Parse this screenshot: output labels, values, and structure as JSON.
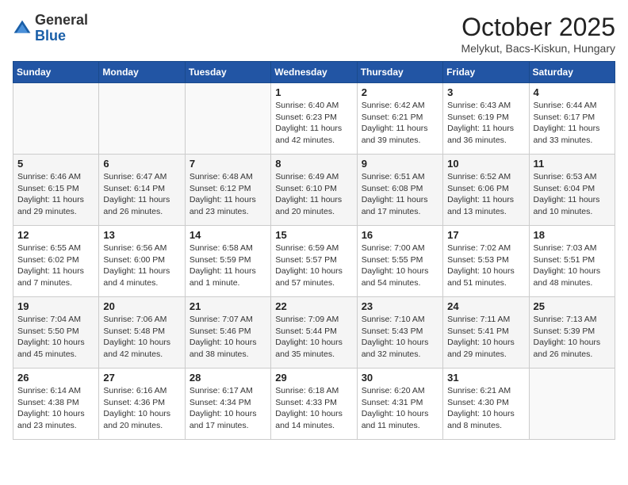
{
  "header": {
    "logo_general": "General",
    "logo_blue": "Blue",
    "month": "October 2025",
    "location": "Melykut, Bacs-Kiskun, Hungary"
  },
  "days_of_week": [
    "Sunday",
    "Monday",
    "Tuesday",
    "Wednesday",
    "Thursday",
    "Friday",
    "Saturday"
  ],
  "weeks": [
    [
      {
        "day": "",
        "info": ""
      },
      {
        "day": "",
        "info": ""
      },
      {
        "day": "",
        "info": ""
      },
      {
        "day": "1",
        "info": "Sunrise: 6:40 AM\nSunset: 6:23 PM\nDaylight: 11 hours and 42 minutes."
      },
      {
        "day": "2",
        "info": "Sunrise: 6:42 AM\nSunset: 6:21 PM\nDaylight: 11 hours and 39 minutes."
      },
      {
        "day": "3",
        "info": "Sunrise: 6:43 AM\nSunset: 6:19 PM\nDaylight: 11 hours and 36 minutes."
      },
      {
        "day": "4",
        "info": "Sunrise: 6:44 AM\nSunset: 6:17 PM\nDaylight: 11 hours and 33 minutes."
      }
    ],
    [
      {
        "day": "5",
        "info": "Sunrise: 6:46 AM\nSunset: 6:15 PM\nDaylight: 11 hours and 29 minutes."
      },
      {
        "day": "6",
        "info": "Sunrise: 6:47 AM\nSunset: 6:14 PM\nDaylight: 11 hours and 26 minutes."
      },
      {
        "day": "7",
        "info": "Sunrise: 6:48 AM\nSunset: 6:12 PM\nDaylight: 11 hours and 23 minutes."
      },
      {
        "day": "8",
        "info": "Sunrise: 6:49 AM\nSunset: 6:10 PM\nDaylight: 11 hours and 20 minutes."
      },
      {
        "day": "9",
        "info": "Sunrise: 6:51 AM\nSunset: 6:08 PM\nDaylight: 11 hours and 17 minutes."
      },
      {
        "day": "10",
        "info": "Sunrise: 6:52 AM\nSunset: 6:06 PM\nDaylight: 11 hours and 13 minutes."
      },
      {
        "day": "11",
        "info": "Sunrise: 6:53 AM\nSunset: 6:04 PM\nDaylight: 11 hours and 10 minutes."
      }
    ],
    [
      {
        "day": "12",
        "info": "Sunrise: 6:55 AM\nSunset: 6:02 PM\nDaylight: 11 hours and 7 minutes."
      },
      {
        "day": "13",
        "info": "Sunrise: 6:56 AM\nSunset: 6:00 PM\nDaylight: 11 hours and 4 minutes."
      },
      {
        "day": "14",
        "info": "Sunrise: 6:58 AM\nSunset: 5:59 PM\nDaylight: 11 hours and 1 minute."
      },
      {
        "day": "15",
        "info": "Sunrise: 6:59 AM\nSunset: 5:57 PM\nDaylight: 10 hours and 57 minutes."
      },
      {
        "day": "16",
        "info": "Sunrise: 7:00 AM\nSunset: 5:55 PM\nDaylight: 10 hours and 54 minutes."
      },
      {
        "day": "17",
        "info": "Sunrise: 7:02 AM\nSunset: 5:53 PM\nDaylight: 10 hours and 51 minutes."
      },
      {
        "day": "18",
        "info": "Sunrise: 7:03 AM\nSunset: 5:51 PM\nDaylight: 10 hours and 48 minutes."
      }
    ],
    [
      {
        "day": "19",
        "info": "Sunrise: 7:04 AM\nSunset: 5:50 PM\nDaylight: 10 hours and 45 minutes."
      },
      {
        "day": "20",
        "info": "Sunrise: 7:06 AM\nSunset: 5:48 PM\nDaylight: 10 hours and 42 minutes."
      },
      {
        "day": "21",
        "info": "Sunrise: 7:07 AM\nSunset: 5:46 PM\nDaylight: 10 hours and 38 minutes."
      },
      {
        "day": "22",
        "info": "Sunrise: 7:09 AM\nSunset: 5:44 PM\nDaylight: 10 hours and 35 minutes."
      },
      {
        "day": "23",
        "info": "Sunrise: 7:10 AM\nSunset: 5:43 PM\nDaylight: 10 hours and 32 minutes."
      },
      {
        "day": "24",
        "info": "Sunrise: 7:11 AM\nSunset: 5:41 PM\nDaylight: 10 hours and 29 minutes."
      },
      {
        "day": "25",
        "info": "Sunrise: 7:13 AM\nSunset: 5:39 PM\nDaylight: 10 hours and 26 minutes."
      }
    ],
    [
      {
        "day": "26",
        "info": "Sunrise: 6:14 AM\nSunset: 4:38 PM\nDaylight: 10 hours and 23 minutes."
      },
      {
        "day": "27",
        "info": "Sunrise: 6:16 AM\nSunset: 4:36 PM\nDaylight: 10 hours and 20 minutes."
      },
      {
        "day": "28",
        "info": "Sunrise: 6:17 AM\nSunset: 4:34 PM\nDaylight: 10 hours and 17 minutes."
      },
      {
        "day": "29",
        "info": "Sunrise: 6:18 AM\nSunset: 4:33 PM\nDaylight: 10 hours and 14 minutes."
      },
      {
        "day": "30",
        "info": "Sunrise: 6:20 AM\nSunset: 4:31 PM\nDaylight: 10 hours and 11 minutes."
      },
      {
        "day": "31",
        "info": "Sunrise: 6:21 AM\nSunset: 4:30 PM\nDaylight: 10 hours and 8 minutes."
      },
      {
        "day": "",
        "info": ""
      }
    ]
  ]
}
